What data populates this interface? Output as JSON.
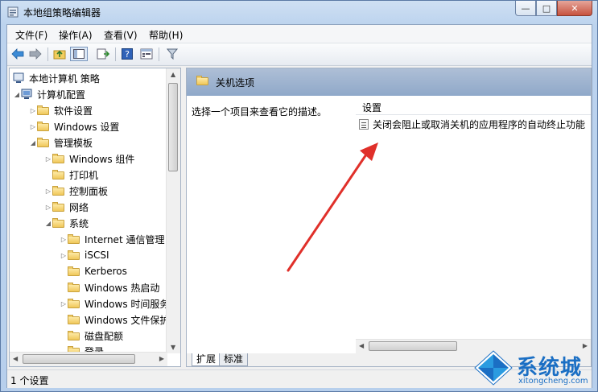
{
  "window": {
    "title": "本地组策略编辑器",
    "controls": [
      "—",
      "□",
      "✕"
    ]
  },
  "menu": {
    "items": [
      "文件(F)",
      "操作(A)",
      "查看(V)",
      "帮助(H)"
    ]
  },
  "tree": {
    "items": [
      {
        "label": "本地计算机 策略",
        "depth": 0
      },
      {
        "label": "计算机配置",
        "depth": 1
      },
      {
        "label": "软件设置",
        "depth": 2
      },
      {
        "label": "Windows 设置",
        "depth": 2
      },
      {
        "label": "管理模板",
        "depth": 2
      },
      {
        "label": "Windows 组件",
        "depth": 3
      },
      {
        "label": "打印机",
        "depth": 3
      },
      {
        "label": "控制面板",
        "depth": 3
      },
      {
        "label": "网络",
        "depth": 3
      },
      {
        "label": "系统",
        "depth": 3
      },
      {
        "label": "Internet 通信管理",
        "depth": 4
      },
      {
        "label": "iSCSI",
        "depth": 4
      },
      {
        "label": "Kerberos",
        "depth": 4
      },
      {
        "label": "Windows 热启动",
        "depth": 4
      },
      {
        "label": "Windows 时间服务",
        "depth": 4
      },
      {
        "label": "Windows 文件保护",
        "depth": 4
      },
      {
        "label": "磁盘配额",
        "depth": 4
      },
      {
        "label": "登录",
        "depth": 4
      }
    ]
  },
  "content": {
    "header_title": "关机选项",
    "description": "选择一个项目来查看它的描述。",
    "column_header": "设置",
    "settings": [
      "关闭会阻止或取消关机的应用程序的自动终止功能"
    ]
  },
  "tabs": [
    "扩展",
    "标准"
  ],
  "status": {
    "text": "1 个设置"
  },
  "watermark": {
    "name": "系统城",
    "url": "xitongcheng.com"
  },
  "colors": {
    "arrow": "#e0302a",
    "header_bg": "#9cb3d1",
    "logo": "#1b6fc4"
  }
}
